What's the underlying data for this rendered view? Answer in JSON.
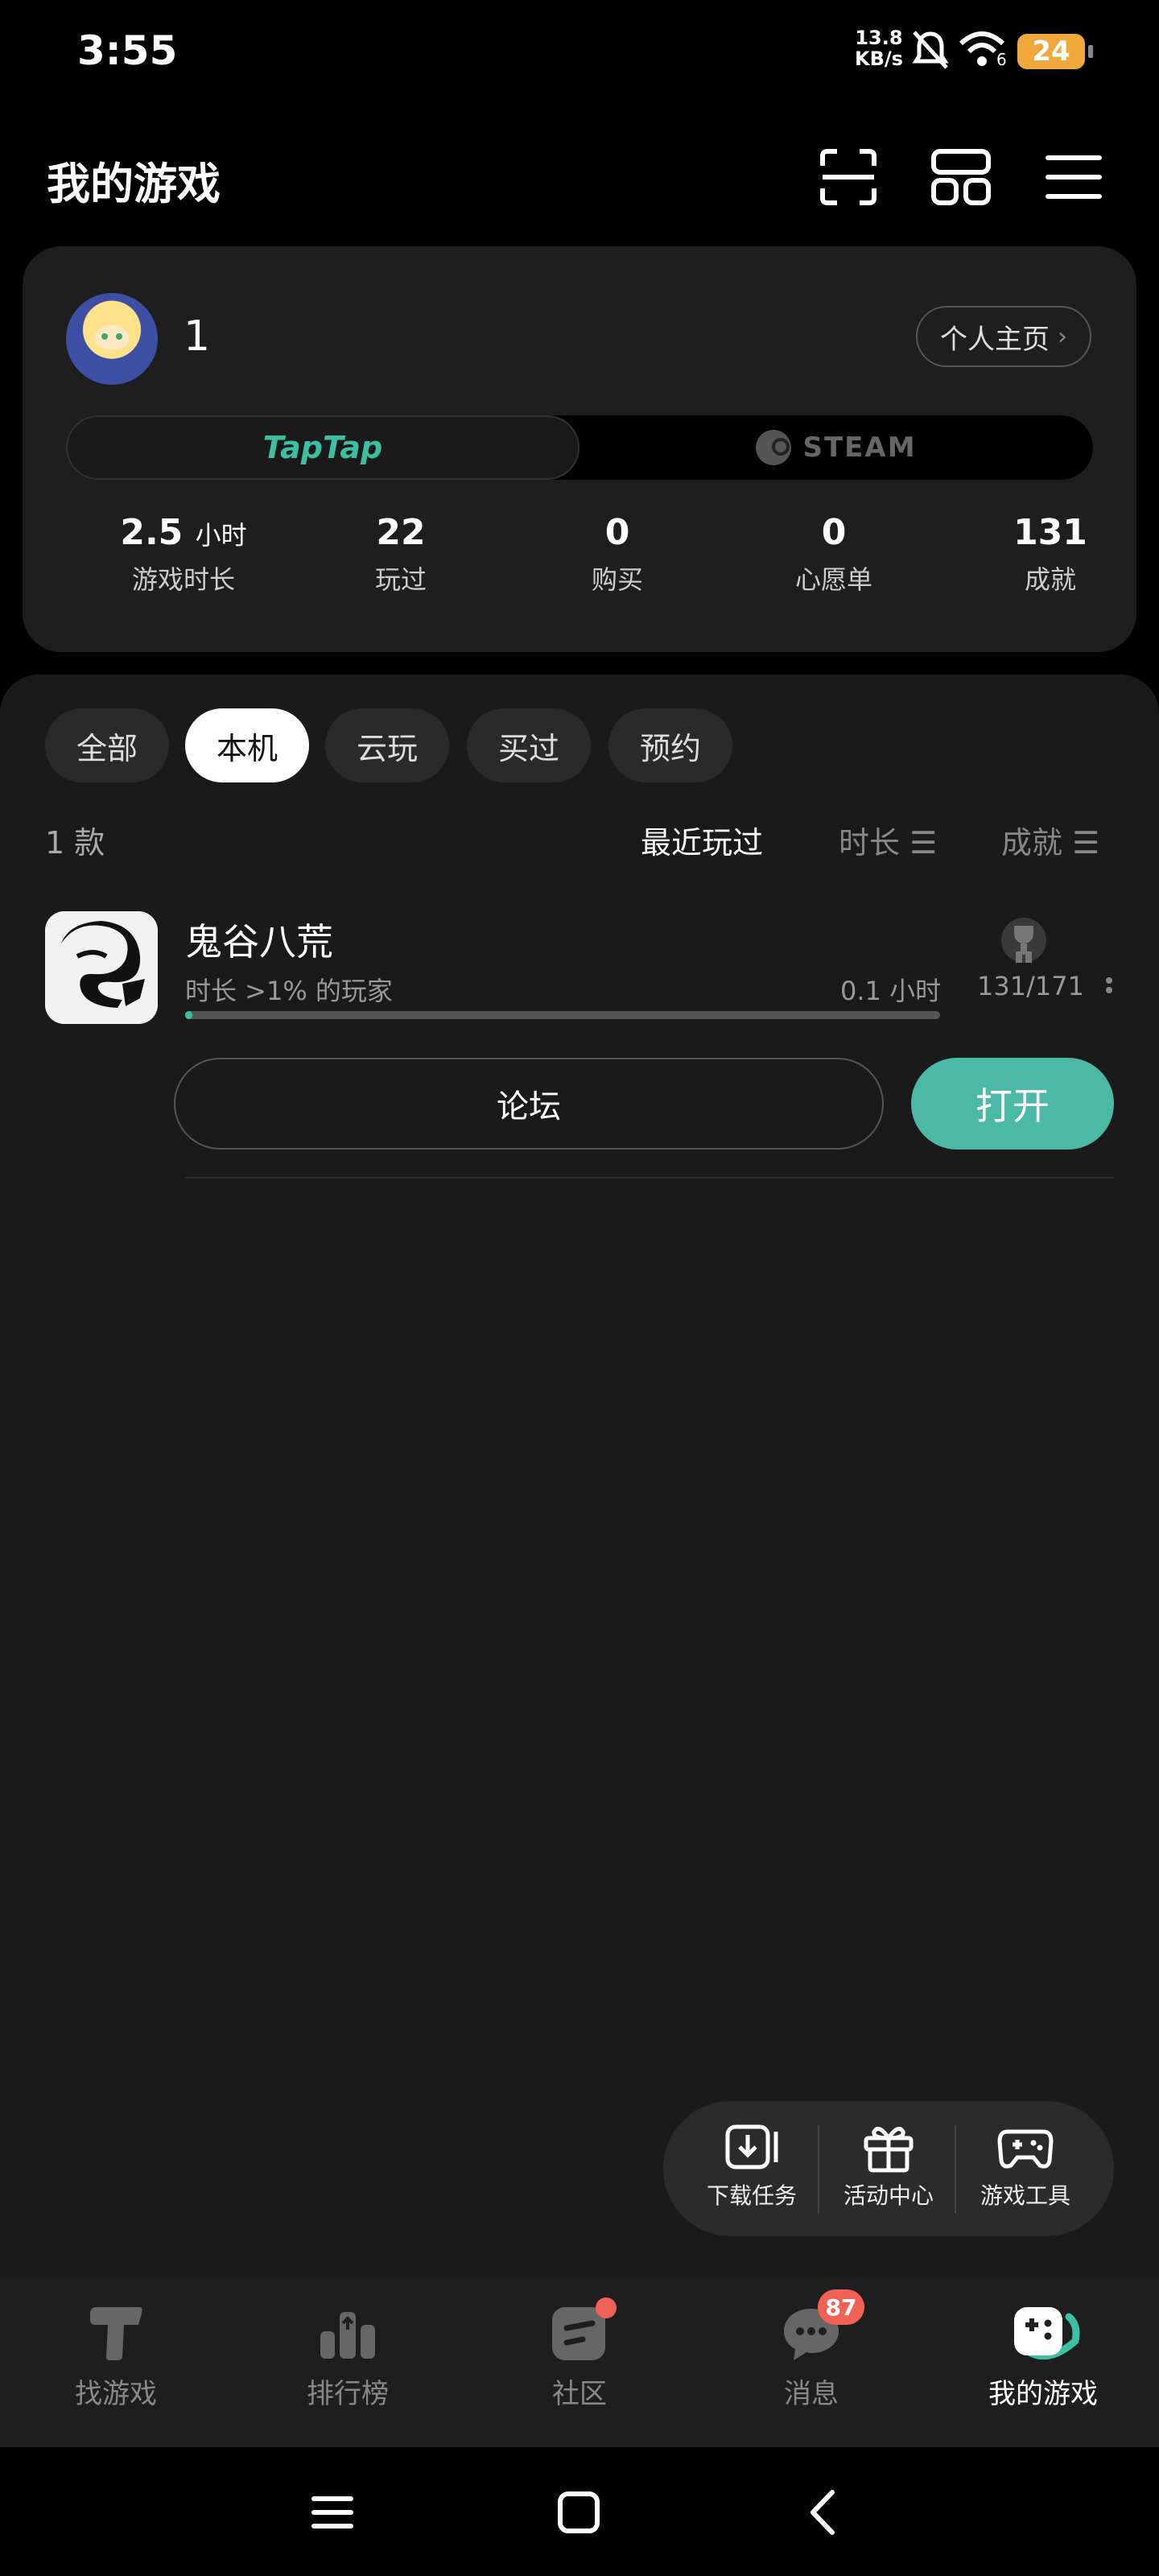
{
  "status_bar": {
    "time": "3:55",
    "net_speed_value": "13.8",
    "net_speed_unit": "KB/s",
    "wifi_sub": "6",
    "battery": "24"
  },
  "header": {
    "title": "我的游戏",
    "icons": [
      "scan-icon",
      "layout-grid-icon",
      "menu-icon"
    ]
  },
  "profile": {
    "name": "1",
    "profile_link": "个人主页",
    "platforms": {
      "taptap": "TapTap",
      "steam": "STEAM"
    },
    "stats": [
      {
        "value": "2.5",
        "unit": "小时",
        "label": "游戏时长"
      },
      {
        "value": "22",
        "unit": "",
        "label": "玩过"
      },
      {
        "value": "0",
        "unit": "",
        "label": "购买"
      },
      {
        "value": "0",
        "unit": "",
        "label": "心愿单"
      },
      {
        "value": "131",
        "unit": "",
        "label": "成就"
      }
    ]
  },
  "filters": {
    "chips": [
      "全部",
      "本机",
      "云玩",
      "买过",
      "预约"
    ],
    "active_chip": "本机",
    "count": "1 款",
    "sort": [
      "最近玩过",
      "时长 ☰",
      "成就 ☰"
    ],
    "active_sort": "最近玩过"
  },
  "games": [
    {
      "name": "鬼谷八荒",
      "subtitle": "时长 >1% 的玩家",
      "hours": "0.1 小时",
      "achievement": "131/171",
      "progress": 0.01,
      "forum_label": "论坛",
      "open_label": "打开"
    }
  ],
  "float_tools": [
    {
      "label": "下载任务",
      "icon": "download-icon"
    },
    {
      "label": "活动中心",
      "icon": "gift-icon"
    },
    {
      "label": "游戏工具",
      "icon": "gamepad-icon"
    }
  ],
  "bottom_nav": [
    {
      "label": "找游戏",
      "icon": "find-games-icon"
    },
    {
      "label": "排行榜",
      "icon": "ranking-icon"
    },
    {
      "label": "社区",
      "icon": "community-icon"
    },
    {
      "label": "消息",
      "icon": "message-icon",
      "badge": "87"
    },
    {
      "label": "我的游戏",
      "icon": "my-games-icon",
      "active": true
    }
  ],
  "colors": {
    "accent": "#3dbfa3",
    "open_button": "#4cb8a6",
    "badge": "#f26155",
    "battery": "#f0a83a"
  }
}
